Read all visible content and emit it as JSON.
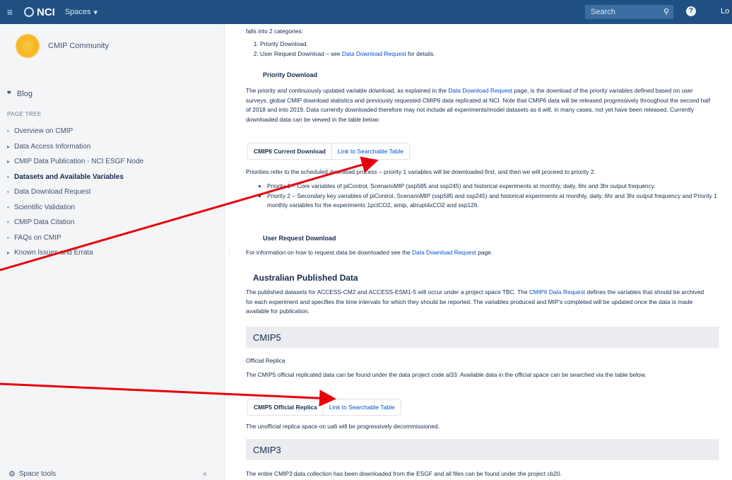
{
  "topbar": {
    "logo_text": "NCI",
    "spaces_label": "Spaces",
    "search_placeholder": "Search",
    "login_label": "Lo",
    "colors": {
      "bar": "#205081"
    }
  },
  "sidebar": {
    "space_name": "CMIP Community",
    "blog_label": "Blog",
    "page_tree_heading": "PAGE TREE",
    "items": [
      {
        "label": "Overview on CMIP",
        "expandable": false,
        "active": false
      },
      {
        "label": "Data Access Information",
        "expandable": true,
        "active": false
      },
      {
        "label": "CMIP Data Publication - NCI ESGF Node",
        "expandable": true,
        "active": false
      },
      {
        "label": "Datasets and Available Variables",
        "expandable": false,
        "active": true
      },
      {
        "label": "Data Download Request",
        "expandable": false,
        "active": false
      },
      {
        "label": "Scientific Validation",
        "expandable": false,
        "active": false
      },
      {
        "label": "CMIP Data Citation",
        "expandable": false,
        "active": false
      },
      {
        "label": "FAQs on CMIP",
        "expandable": false,
        "active": false
      },
      {
        "label": "Known Issues and Errata",
        "expandable": true,
        "active": false
      }
    ],
    "space_tools_label": "Space tools"
  },
  "content": {
    "intro": "falls into 2 categories:",
    "list": [
      {
        "text": "Priority Download."
      },
      {
        "pre": "User Request Download – see ",
        "link": "Data Download Request",
        "post": " for details."
      }
    ],
    "priority_heading": "Priority Download",
    "priority_para_pre": "The priority and continuously updated variable download, as explained in the ",
    "priority_para_link": "Data Download Request",
    "priority_para_post": " page, is the download of the priority variables defined based on user surveys, global CMIP download statistics and previously requested CMIP6 data replicated at NCI. Note that CMIP6 data will be released progressively throughout the second half of 2018 and into 2019. Data currently downloaded therefore may not include all experiments/model datasets as it will, in many cases, not yet have been released. Currently downloaded data can be viewed in the table below:",
    "cmip6_box_label": "CMIP6 Current Download",
    "cmip6_box_link": "Link to Searchable Table",
    "priorities_para": "Priorities refer to the scheduled download process – priority 1 variables will be downloaded first, and then we will proceed to priority 2.",
    "bullets": [
      "Priority 1 – Core variables of piControl, ScenarioMIP (ssp585 and ssp245) and historical experiments at monthly, daily, 6hr and 3hr output frequency.",
      "Priority 2 – Secondary key variables of piControl, ScenarioMIP (ssp585 and ssp245) and historical experiments at monthly, daily, 6hr and 3hr output frequency and Priority 1 monthly variables for the experiments 1pctCO2, amip, abrupt4xCO2 and ssp126."
    ],
    "user_request_heading": "User Request Download",
    "user_request_pre": "For information on how to request data be downloaded see the ",
    "user_request_link": "Data Download Request",
    "user_request_post": " page.",
    "au_heading": "Australian Published Data",
    "au_para_pre": "The published datasets for ACCESS-CM2 and ACCESS-ESM1-5 will occur under a project space TBC. The ",
    "au_para_link": "CMIP6 Data Request",
    "au_para_post": " defines the variables that should be archived for each experiment and specifies the time intervals for which they should be reported. The variables produced and MIP's completed will be updated once the data is made available for publication.",
    "cmip5_heading": "CMIP5",
    "official_replica_label": "Official Replica",
    "cmip5_para": "The CMIP5 official replicated data can be found under the data project code al33. Available data in the official space can be searched via the table below.",
    "cmip5_box_label": "CMIP5 Official Replica",
    "cmip5_box_link": "Link to Searchable Table",
    "unofficial_para": "The unofficial replica space on ua6 will be progressively decommissioned.",
    "cmip3_heading": "CMIP3",
    "cmip3_para": "The entire CMIP3 data collection has been downloaded from the ESGF and all files can be found under the project cb20."
  },
  "annotation": {
    "arrow_color": "#e8000b"
  }
}
